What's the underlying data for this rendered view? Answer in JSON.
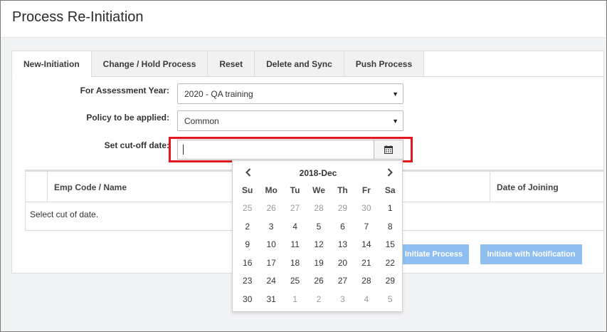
{
  "page": {
    "title": "Process Re-Initiation"
  },
  "tabs": [
    {
      "label": "New-Initiation"
    },
    {
      "label": "Change / Hold Process"
    },
    {
      "label": "Reset"
    },
    {
      "label": "Delete and Sync"
    },
    {
      "label": "Push Process"
    }
  ],
  "form": {
    "assessment_year_label": "For Assessment Year:",
    "assessment_year_value": "2020 - QA training",
    "policy_label": "Policy to be applied:",
    "policy_value": "Common",
    "cutoff_label": "Set cut-off date:",
    "cutoff_value": ""
  },
  "grid": {
    "columns": [
      "Emp Code / Name",
      "Date of Joining"
    ],
    "empty_message": "Select cut of date."
  },
  "buttons": {
    "initiate": "Initiate Process",
    "initiate_notify": "Initiate with Notification"
  },
  "calendar": {
    "title": "2018-Dec",
    "weekdays": [
      "Su",
      "Mo",
      "Tu",
      "We",
      "Th",
      "Fr",
      "Sa"
    ],
    "weeks": [
      [
        {
          "d": "25",
          "m": true
        },
        {
          "d": "26",
          "m": true
        },
        {
          "d": "27",
          "m": true
        },
        {
          "d": "28",
          "m": true
        },
        {
          "d": "29",
          "m": true
        },
        {
          "d": "30",
          "m": true
        },
        {
          "d": "1",
          "m": false
        }
      ],
      [
        {
          "d": "2",
          "m": false
        },
        {
          "d": "3",
          "m": false
        },
        {
          "d": "4",
          "m": false
        },
        {
          "d": "5",
          "m": false
        },
        {
          "d": "6",
          "m": false
        },
        {
          "d": "7",
          "m": false
        },
        {
          "d": "8",
          "m": false
        }
      ],
      [
        {
          "d": "9",
          "m": false
        },
        {
          "d": "10",
          "m": false
        },
        {
          "d": "11",
          "m": false
        },
        {
          "d": "12",
          "m": false
        },
        {
          "d": "13",
          "m": false
        },
        {
          "d": "14",
          "m": false
        },
        {
          "d": "15",
          "m": false
        }
      ],
      [
        {
          "d": "16",
          "m": false
        },
        {
          "d": "17",
          "m": false
        },
        {
          "d": "18",
          "m": false
        },
        {
          "d": "19",
          "m": false
        },
        {
          "d": "20",
          "m": false
        },
        {
          "d": "21",
          "m": false
        },
        {
          "d": "22",
          "m": false
        }
      ],
      [
        {
          "d": "23",
          "m": false
        },
        {
          "d": "24",
          "m": false
        },
        {
          "d": "25",
          "m": false
        },
        {
          "d": "26",
          "m": false
        },
        {
          "d": "27",
          "m": false
        },
        {
          "d": "28",
          "m": false
        },
        {
          "d": "29",
          "m": false
        }
      ],
      [
        {
          "d": "30",
          "m": false
        },
        {
          "d": "31",
          "m": false
        },
        {
          "d": "1",
          "m": true
        },
        {
          "d": "2",
          "m": true
        },
        {
          "d": "3",
          "m": true
        },
        {
          "d": "4",
          "m": true
        },
        {
          "d": "5",
          "m": true
        }
      ]
    ]
  },
  "icons": {
    "calendar": "calendar-icon",
    "prev": "chevron-left-icon",
    "next": "chevron-right-icon",
    "dropdown": "caret-down-icon"
  },
  "colors": {
    "highlight": "#e1191f",
    "button_primary": "#8fbff0"
  }
}
